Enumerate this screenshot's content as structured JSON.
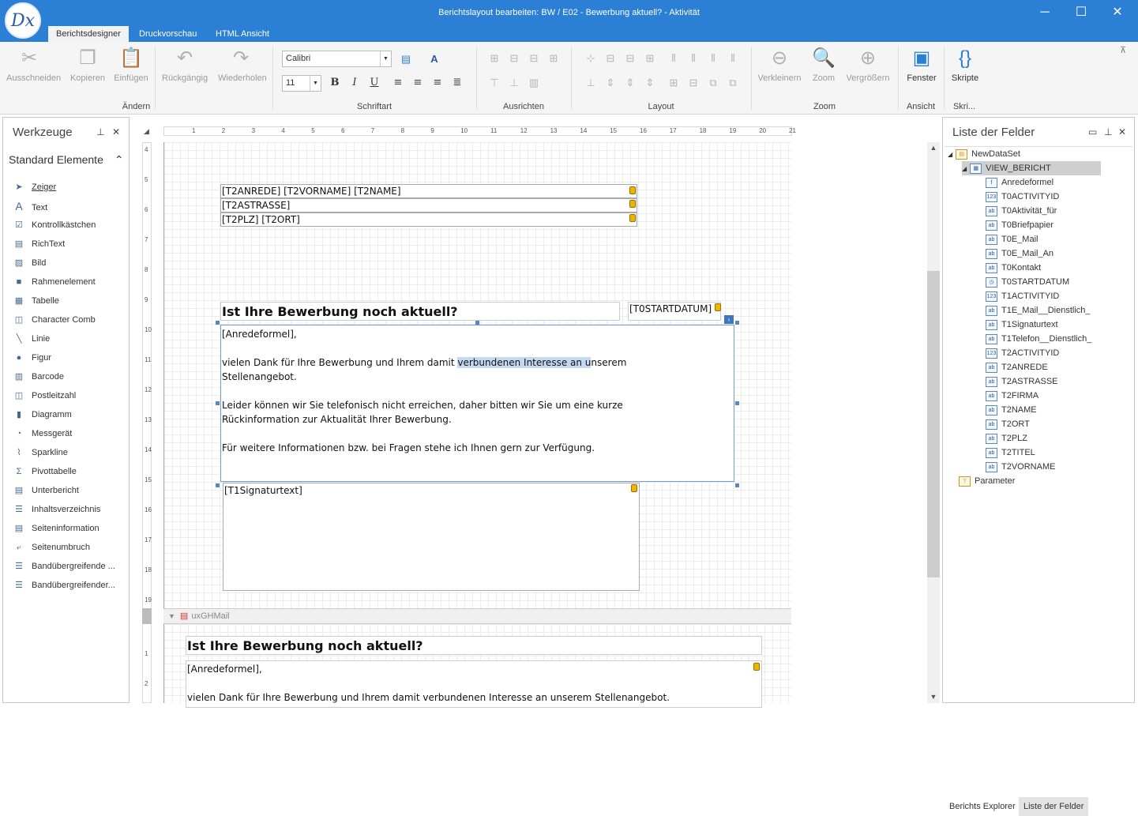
{
  "window": {
    "title": "Berichtslayout bearbeiten: BW / E02 - Bewerbung aktuell? - Aktivität",
    "logo_text": "Dx"
  },
  "tabs": [
    "Berichtsdesigner",
    "Druckvorschau",
    "HTML Ansicht"
  ],
  "ribbon": {
    "edit_buttons": [
      "Ausschneiden",
      "Kopieren",
      "Einfügen"
    ],
    "undo_buttons": [
      "Rückgängig",
      "Wiederholen"
    ],
    "group_aendern": "Ändern",
    "font_name": "Calibri",
    "font_size": "11",
    "group_schriftart": "Schriftart",
    "group_ausrichten": "Ausrichten",
    "group_layout": "Layout",
    "zoom_buttons": [
      "Verkleinern",
      "Zoom",
      "Vergrößern"
    ],
    "group_zoom": "Zoom",
    "fenster": "Fenster",
    "group_ansicht": "Ansicht",
    "skripte": "Skripte",
    "group_skri": "Skri..."
  },
  "toolbox": {
    "title": "Werkzeuge",
    "section": "Standard Elemente",
    "items": [
      "Zeiger",
      "Text",
      "Kontrollkästchen",
      "RichText",
      "Bild",
      "Rahmenelement",
      "Tabelle",
      "Character Comb",
      "Linie",
      "Figur",
      "Barcode",
      "Postleitzahl",
      "Diagramm",
      "Messgerät",
      "Sparkline",
      "Pivottabelle",
      "Unterbericht",
      "Inhaltsverzeichnis",
      "Seiteninformation",
      "Seitenumbruch",
      "Bandübergreifende ...",
      "Bandübergreifender..."
    ]
  },
  "ruler": {
    "h": [
      "1",
      "2",
      "3",
      "4",
      "5",
      "6",
      "7",
      "8",
      "9",
      "10",
      "11",
      "12",
      "13",
      "14",
      "15",
      "16",
      "17",
      "18",
      "19",
      "20",
      "21"
    ],
    "v": [
      "4",
      "5",
      "6",
      "7",
      "8",
      "9",
      "10",
      "11",
      "12",
      "13",
      "14",
      "15",
      "16",
      "17",
      "18",
      "19"
    ],
    "v2": [
      "1",
      "2"
    ]
  },
  "report": {
    "addr1": "[T2ANREDE] [T2VORNAME] [T2NAME]",
    "addr2": "[T2ASTRASSE]",
    "addr3": "[T2PLZ] [T2ORT]",
    "heading": "Ist Ihre Bewerbung noch  aktuell?",
    "date_field": "[T0STARTDATUM]",
    "salutation": "[Anredeformel],",
    "p1a": "vielen Dank für Ihre Bewerbung und Ihrem damit ",
    "p1hl": "verbundenen Interesse an u",
    "p1b": "nserem",
    "p1c": "Stellenangebot.",
    "p2a": "Leider können wir Sie telefonisch nicht erreichen, daher bitten wir Sie um eine kurze",
    "p2b": "Rückinformation zur Aktualität Ihrer Bewerbung.",
    "p3": "Für weitere Informationen bzw. bei Fragen stehe ich Ihnen gern zur Verfügung.",
    "signature": "[T1Signaturtext]",
    "band_name": "uxGHMail",
    "heading2": "Ist Ihre Bewerbung noch  aktuell?",
    "salutation2": "[Anredeformel],",
    "p1_2": "vielen Dank für Ihre Bewerbung und Ihrem damit verbundenen Interesse an unserem Stellenangebot."
  },
  "fields_panel": {
    "title": "Liste der Felder",
    "dataset": "NewDataSet",
    "view": "VIEW_BERICHT",
    "fields": [
      {
        "name": "Anredeformel",
        "icon": "f"
      },
      {
        "name": "T0ACTIVITYID",
        "icon": "123"
      },
      {
        "name": "T0Aktivität_für",
        "icon": "ab"
      },
      {
        "name": "T0Briefpapier",
        "icon": "ab"
      },
      {
        "name": "T0E_Mail",
        "icon": "ab"
      },
      {
        "name": "T0E_Mail_An",
        "icon": "ab"
      },
      {
        "name": "T0Kontakt",
        "icon": "ab"
      },
      {
        "name": "T0STARTDATUM",
        "icon": "◷"
      },
      {
        "name": "T1ACTIVITYID",
        "icon": "123"
      },
      {
        "name": "T1E_Mail__Dienstlich_",
        "icon": "ab"
      },
      {
        "name": "T1Signaturtext",
        "icon": "ab"
      },
      {
        "name": "T1Telefon__Dienstlich_",
        "icon": "ab"
      },
      {
        "name": "T2ACTIVITYID",
        "icon": "123"
      },
      {
        "name": "T2ANREDE",
        "icon": "ab"
      },
      {
        "name": "T2ASTRASSE",
        "icon": "ab"
      },
      {
        "name": "T2FIRMA",
        "icon": "ab"
      },
      {
        "name": "T2NAME",
        "icon": "ab"
      },
      {
        "name": "T2ORT",
        "icon": "ab"
      },
      {
        "name": "T2PLZ",
        "icon": "ab"
      },
      {
        "name": "T2TITEL",
        "icon": "ab"
      },
      {
        "name": "T2VORNAME",
        "icon": "ab"
      }
    ],
    "parameter": "Parameter",
    "bottom_tabs": [
      "Berichts Explorer",
      "Liste der Felder"
    ]
  }
}
